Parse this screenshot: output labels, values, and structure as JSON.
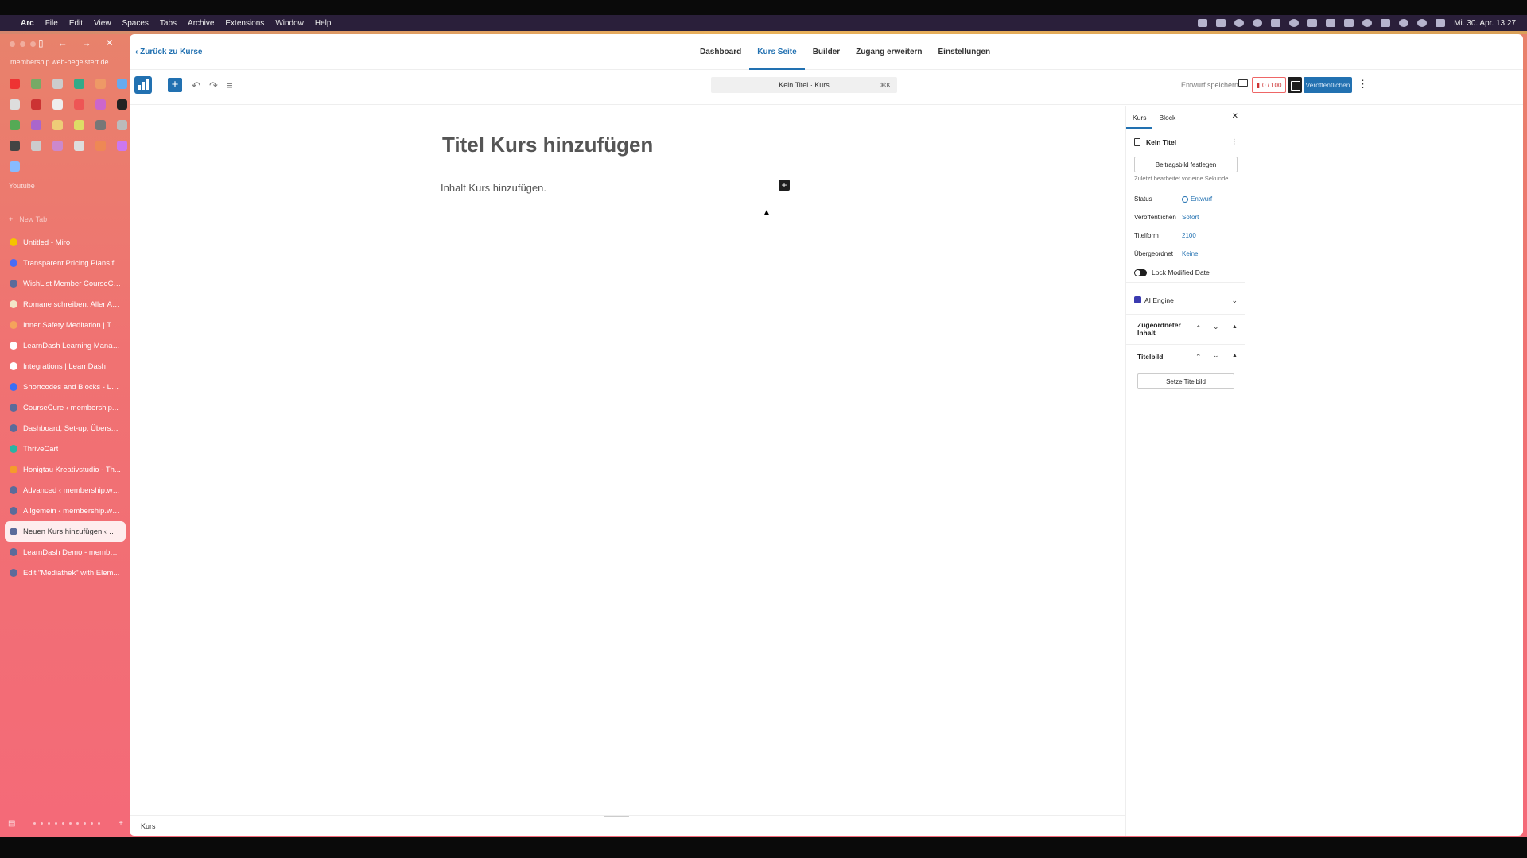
{
  "menubar": {
    "app": "Arc",
    "items": [
      "File",
      "Edit",
      "View",
      "Spaces",
      "Tabs",
      "Archive",
      "Extensions",
      "Window",
      "Help"
    ],
    "clock": "Mi. 30. Apr. 13:27"
  },
  "sidebar": {
    "url": "membership.web-begeistert.de",
    "section_title": "Youtube",
    "new_tab": "New Tab",
    "favorites_colors": [
      "#e33",
      "#7a6",
      "#ccc",
      "#3a8",
      "#e96",
      "#6ae",
      "#ddd",
      "#c33",
      "#eee",
      "#e55",
      "#c6c",
      "#222",
      "#5a5",
      "#a6c",
      "#ec7",
      "#dd6",
      "#777",
      "#bbb",
      "#444",
      "#ccc",
      "#c8c",
      "#ddd",
      "#e85",
      "#c7e",
      "#8bf"
    ],
    "tabs": [
      {
        "label": "Untitled - Miro",
        "color": "#f5c400"
      },
      {
        "label": "Transparent Pricing Plans f...",
        "color": "#4a6cf7"
      },
      {
        "label": "WishList Member CourseCu...",
        "color": "#5b6b9a"
      },
      {
        "label": "Romane schreiben: Aller An...",
        "color": "#f2e6c8"
      },
      {
        "label": "Inner Safety Meditation | Th...",
        "color": "#f5a35b"
      },
      {
        "label": "LearnDash Learning Manag...",
        "color": "#ffffff"
      },
      {
        "label": "Integrations | LearnDash",
        "color": "#ffffff"
      },
      {
        "label": "Shortcodes and Blocks - Le...",
        "color": "#3b6ef5"
      },
      {
        "label": "CourseCure ‹ membership...",
        "color": "#5b6b9a"
      },
      {
        "label": "Dashboard, Set-up, Überse...",
        "color": "#5b6b9a"
      },
      {
        "label": "ThriveCart",
        "color": "#2bb3a3"
      },
      {
        "label": "Honigtau Kreativstudio - Th...",
        "color": "#f59b2b"
      },
      {
        "label": "Advanced ‹ membership.we...",
        "color": "#5b6b9a"
      },
      {
        "label": "Allgemein ‹ membership.we...",
        "color": "#5b6b9a"
      },
      {
        "label": "Neuen Kurs hinzufügen ‹ m...",
        "color": "#5b6b9a",
        "active": true
      },
      {
        "label": "LearnDash Demo - member...",
        "color": "#5b6b9a"
      },
      {
        "label": "Edit \"Mediathek\" with Elem...",
        "color": "#5b6b9a"
      }
    ]
  },
  "topnav": {
    "back": "Zurück zu Kurse",
    "tabs": [
      "Dashboard",
      "Kurs Seite",
      "Builder",
      "Zugang erweitern",
      "Einstellungen"
    ],
    "active_tab": "Kurs Seite"
  },
  "toolbar": {
    "command_bar": "Kein Titel · Kurs",
    "shortcut": "⌘K",
    "save_draft": "Entwurf speichern",
    "score": "0 / 100",
    "publish": "Veröffentlichen"
  },
  "editor": {
    "title_placeholder": "Titel Kurs hinzufügen",
    "content_placeholder": "Inhalt Kurs hinzufügen.",
    "status_bar": "Kurs"
  },
  "panel": {
    "tabs": [
      "Kurs",
      "Block"
    ],
    "doc_title": "Kein Titel",
    "featured_image_button": "Beitragsbild festlegen",
    "last_edited": "Zuletzt bearbeitet vor eine Sekunde.",
    "rows": [
      {
        "label": "Status",
        "value": "Entwurf"
      },
      {
        "label": "Veröffentlichen",
        "value": "Sofort"
      },
      {
        "label": "Titelform",
        "value": "2100"
      },
      {
        "label": "Übergeordnet",
        "value": "Keine"
      }
    ],
    "lock_label": "Lock Modified Date",
    "ai_engine": "AI Engine",
    "assigned_content": "Zugeordneter Inhalt",
    "title_image": "Titelbild",
    "set_title_image": "Setze Titelbild"
  },
  "colors": {
    "accent": "#2271b1",
    "sidebar_top": "#e8826b",
    "sidebar_bottom": "#f46a78"
  }
}
